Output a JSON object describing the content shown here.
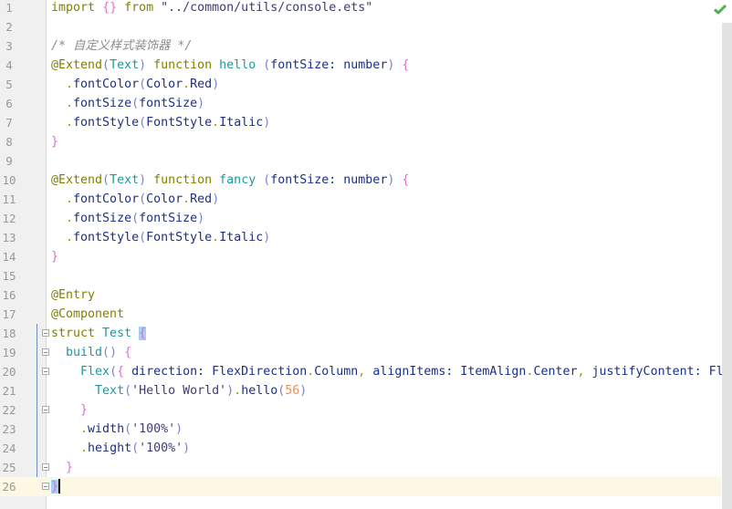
{
  "status": {
    "icon": "check-icon",
    "color": "#4caf50"
  },
  "colors": {
    "keyword": "#808000",
    "plain": "#1c2f8a",
    "type": "#1b9a9d",
    "paren": "#7b80d6",
    "brace": "#e070c8",
    "string": "#3d3c75",
    "comment": "#8c8c8c",
    "number": "#ef8c5f"
  },
  "current_line": 26,
  "lines": [
    {
      "n": "1",
      "tokens": [
        [
          "import",
          "kw"
        ],
        [
          " ",
          "pl"
        ],
        [
          "{}",
          "br"
        ],
        [
          " from ",
          "kw"
        ],
        [
          "\"../common/utils/console.ets\"",
          "st"
        ]
      ]
    },
    {
      "n": "2",
      "tokens": []
    },
    {
      "n": "3",
      "tokens": [
        [
          "/* 自定义样式装饰器 */",
          "cm"
        ]
      ]
    },
    {
      "n": "4",
      "tokens": [
        [
          "@Extend",
          "kw"
        ],
        [
          "(",
          "pa"
        ],
        [
          "Text",
          "te"
        ],
        [
          ")",
          "pa"
        ],
        [
          " function ",
          "kw"
        ],
        [
          "hello",
          "te"
        ],
        [
          " ",
          "pl"
        ],
        [
          "(",
          "pa"
        ],
        [
          "fontSize: number",
          "pl"
        ],
        [
          ")",
          "pa"
        ],
        [
          " ",
          "pl"
        ],
        [
          "{",
          "br"
        ]
      ]
    },
    {
      "n": "5",
      "tokens": [
        [
          "  ",
          "pl"
        ],
        [
          ".",
          "pu"
        ],
        [
          "fontColor",
          "pl"
        ],
        [
          "(",
          "pa"
        ],
        [
          "Color",
          "pl"
        ],
        [
          ".",
          "pu"
        ],
        [
          "Red",
          "pl"
        ],
        [
          ")",
          "pa"
        ]
      ]
    },
    {
      "n": "6",
      "tokens": [
        [
          "  ",
          "pl"
        ],
        [
          ".",
          "pu"
        ],
        [
          "fontSize",
          "pl"
        ],
        [
          "(",
          "pa"
        ],
        [
          "fontSize",
          "pl"
        ],
        [
          ")",
          "pa"
        ]
      ]
    },
    {
      "n": "7",
      "tokens": [
        [
          "  ",
          "pl"
        ],
        [
          ".",
          "pu"
        ],
        [
          "fontStyle",
          "pl"
        ],
        [
          "(",
          "pa"
        ],
        [
          "FontStyle",
          "pl"
        ],
        [
          ".",
          "pu"
        ],
        [
          "Italic",
          "pl"
        ],
        [
          ")",
          "pa"
        ]
      ]
    },
    {
      "n": "8",
      "tokens": [
        [
          "}",
          "br"
        ]
      ]
    },
    {
      "n": "9",
      "tokens": []
    },
    {
      "n": "10",
      "tokens": [
        [
          "@Extend",
          "kw"
        ],
        [
          "(",
          "pa"
        ],
        [
          "Text",
          "te"
        ],
        [
          ")",
          "pa"
        ],
        [
          " function ",
          "kw"
        ],
        [
          "fancy",
          "te"
        ],
        [
          " ",
          "pl"
        ],
        [
          "(",
          "pa"
        ],
        [
          "fontSize: number",
          "pl"
        ],
        [
          ")",
          "pa"
        ],
        [
          " ",
          "pl"
        ],
        [
          "{",
          "br"
        ]
      ]
    },
    {
      "n": "11",
      "tokens": [
        [
          "  ",
          "pl"
        ],
        [
          ".",
          "pu"
        ],
        [
          "fontColor",
          "pl"
        ],
        [
          "(",
          "pa"
        ],
        [
          "Color",
          "pl"
        ],
        [
          ".",
          "pu"
        ],
        [
          "Red",
          "pl"
        ],
        [
          ")",
          "pa"
        ]
      ]
    },
    {
      "n": "12",
      "tokens": [
        [
          "  ",
          "pl"
        ],
        [
          ".",
          "pu"
        ],
        [
          "fontSize",
          "pl"
        ],
        [
          "(",
          "pa"
        ],
        [
          "fontSize",
          "pl"
        ],
        [
          ")",
          "pa"
        ]
      ]
    },
    {
      "n": "13",
      "tokens": [
        [
          "  ",
          "pl"
        ],
        [
          ".",
          "pu"
        ],
        [
          "fontStyle",
          "pl"
        ],
        [
          "(",
          "pa"
        ],
        [
          "FontStyle",
          "pl"
        ],
        [
          ".",
          "pu"
        ],
        [
          "Italic",
          "pl"
        ],
        [
          ")",
          "pa"
        ]
      ]
    },
    {
      "n": "14",
      "tokens": [
        [
          "}",
          "br"
        ]
      ]
    },
    {
      "n": "15",
      "tokens": []
    },
    {
      "n": "16",
      "tokens": [
        [
          "@Entry",
          "kw"
        ]
      ]
    },
    {
      "n": "17",
      "tokens": [
        [
          "@Component",
          "kw"
        ]
      ]
    },
    {
      "n": "18",
      "fold": true,
      "tokens": [
        [
          "struct",
          "kw"
        ],
        [
          " Test ",
          "te"
        ],
        [
          "{",
          "br hl"
        ]
      ]
    },
    {
      "n": "19",
      "fold": true,
      "tokens": [
        [
          "  ",
          "pl"
        ],
        [
          "build",
          "te"
        ],
        [
          "()",
          "pa"
        ],
        [
          " ",
          "pl"
        ],
        [
          "{",
          "br"
        ]
      ]
    },
    {
      "n": "20",
      "fold": true,
      "tokens": [
        [
          "    ",
          "pl"
        ],
        [
          "Flex",
          "te"
        ],
        [
          "(",
          "pa"
        ],
        [
          "{",
          "br"
        ],
        [
          " direction: FlexDirection",
          "pl"
        ],
        [
          ".",
          "pu"
        ],
        [
          "Column",
          "pl"
        ],
        [
          ",",
          "pu"
        ],
        [
          " alignItems: ItemAlign",
          "pl"
        ],
        [
          ".",
          "pu"
        ],
        [
          "Center",
          "pl"
        ],
        [
          ",",
          "pu"
        ],
        [
          " justifyContent: Fle",
          "pl"
        ]
      ]
    },
    {
      "n": "21",
      "tokens": [
        [
          "      ",
          "pl"
        ],
        [
          "Text",
          "te"
        ],
        [
          "(",
          "pa"
        ],
        [
          "'Hello World'",
          "st"
        ],
        [
          ")",
          "pa"
        ],
        [
          ".",
          "pu"
        ],
        [
          "hello",
          "pl"
        ],
        [
          "(",
          "pa"
        ],
        [
          "56",
          "nu"
        ],
        [
          ")",
          "pa"
        ]
      ]
    },
    {
      "n": "22",
      "fold": true,
      "tokens": [
        [
          "    ",
          "pl"
        ],
        [
          "}",
          "br"
        ]
      ]
    },
    {
      "n": "23",
      "tokens": [
        [
          "    ",
          "pl"
        ],
        [
          ".",
          "pu"
        ],
        [
          "width",
          "pl"
        ],
        [
          "(",
          "pa"
        ],
        [
          "'100%'",
          "st"
        ],
        [
          ")",
          "pa"
        ]
      ]
    },
    {
      "n": "24",
      "tokens": [
        [
          "    ",
          "pl"
        ],
        [
          ".",
          "pu"
        ],
        [
          "height",
          "pl"
        ],
        [
          "(",
          "pa"
        ],
        [
          "'100%'",
          "st"
        ],
        [
          ")",
          "pa"
        ]
      ]
    },
    {
      "n": "25",
      "fold": true,
      "tokens": [
        [
          "  ",
          "pl"
        ],
        [
          "}",
          "br"
        ]
      ]
    },
    {
      "n": "26",
      "fold": true,
      "tokens": [
        [
          "}",
          "br hl"
        ]
      ]
    }
  ]
}
